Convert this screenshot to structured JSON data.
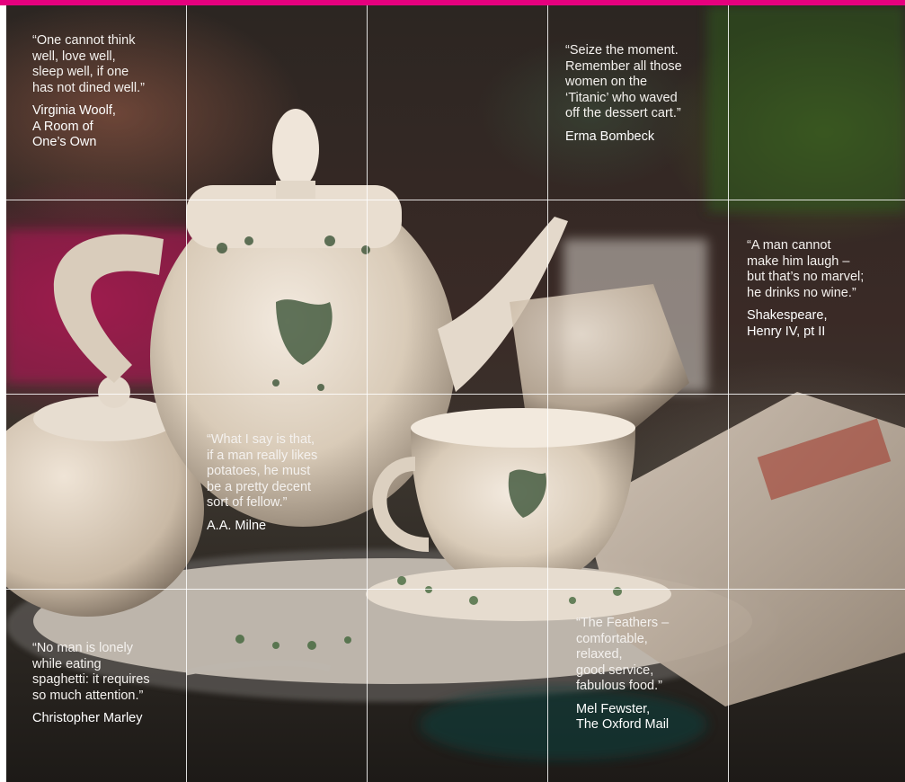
{
  "colors": {
    "accent_bar": "#e6007e",
    "grid_lines": "#ffffff",
    "text": "#ffffff"
  },
  "quotes": [
    {
      "text": "“One cannot think\nwell, love well,\nsleep well, if one\nhas not dined well.”",
      "author": "Virginia Woolf,\nA Room of\nOne’s Own"
    },
    {
      "text": "“Seize the moment.\nRemember all those\nwomen on the\n‘Titanic’ who waved\noff the dessert cart.”",
      "author": "Erma Bombeck"
    },
    {
      "text": "“A man cannot\nmake him laugh –\nbut that’s no marvel;\nhe drinks no wine.”",
      "author": "Shakespeare,\nHenry IV, pt II"
    },
    {
      "text": "“What I say is that,\nif a man really likes\npotatoes, he must\nbe a pretty decent\nsort of fellow.”",
      "author": "A.A. Milne"
    },
    {
      "text": "“No man is lonely\nwhile eating\nspaghetti: it requires\nso much attention.”",
      "author": "Christopher Marley"
    },
    {
      "text": "“The Feathers –\ncomfortable,\nrelaxed,\ngood service,\nfabulous food.”",
      "author": "Mel Fewster,\nThe Oxford Mail"
    }
  ]
}
